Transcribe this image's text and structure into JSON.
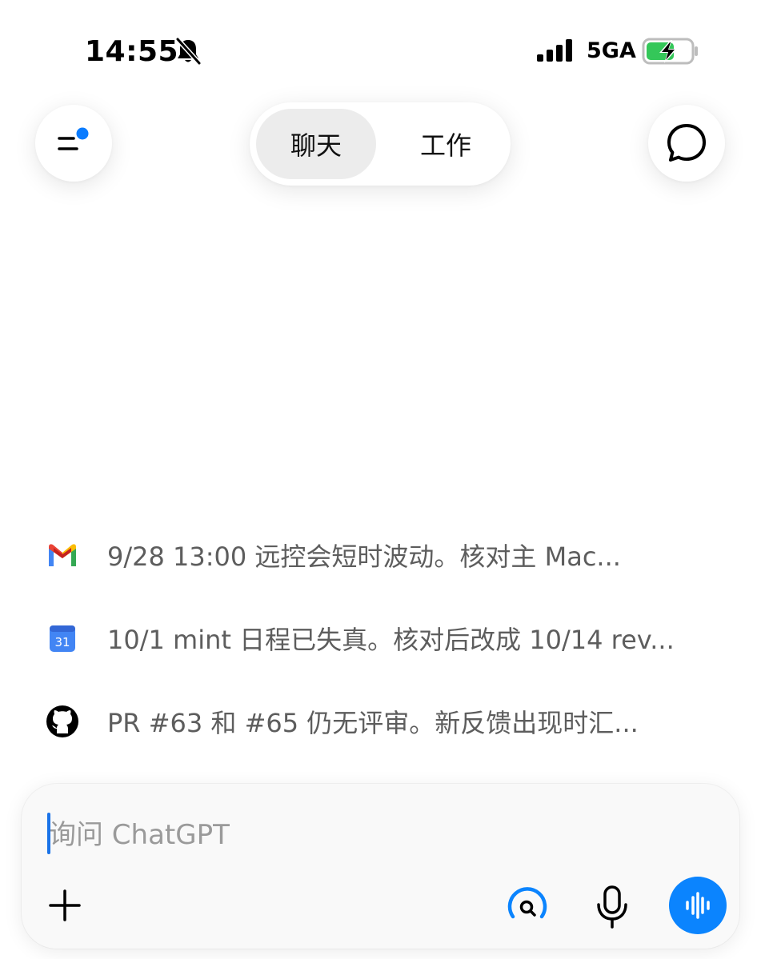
{
  "status_bar": {
    "time": "14:55",
    "network": "5GA",
    "battery_charging": true,
    "battery_level": 0.62
  },
  "header": {
    "tabs": [
      {
        "label": "聊天",
        "active": true
      },
      {
        "label": "工作",
        "active": false
      }
    ],
    "menu_has_notification_dot": true
  },
  "suggestions": [
    {
      "icon": "gmail-icon",
      "text": "9/28 13:00 远控会短时波动。核对主 Mac..."
    },
    {
      "icon": "calendar-icon",
      "calendar_day": "31",
      "text": "10/1 mint 日程已失真。核对后改成 10/14 rev..."
    },
    {
      "icon": "github-icon",
      "text": "PR #63 和 #65 仍无评审。新反馈出现时汇..."
    }
  ],
  "composer": {
    "placeholder": "询问 ChatGPT",
    "value": ""
  },
  "colors": {
    "accent": "#0b84fe",
    "caret": "#1a73e8",
    "notification_dot": "#0a7cff",
    "battery_green": "#34c759",
    "suggestion_text": "#5d5d5d"
  }
}
